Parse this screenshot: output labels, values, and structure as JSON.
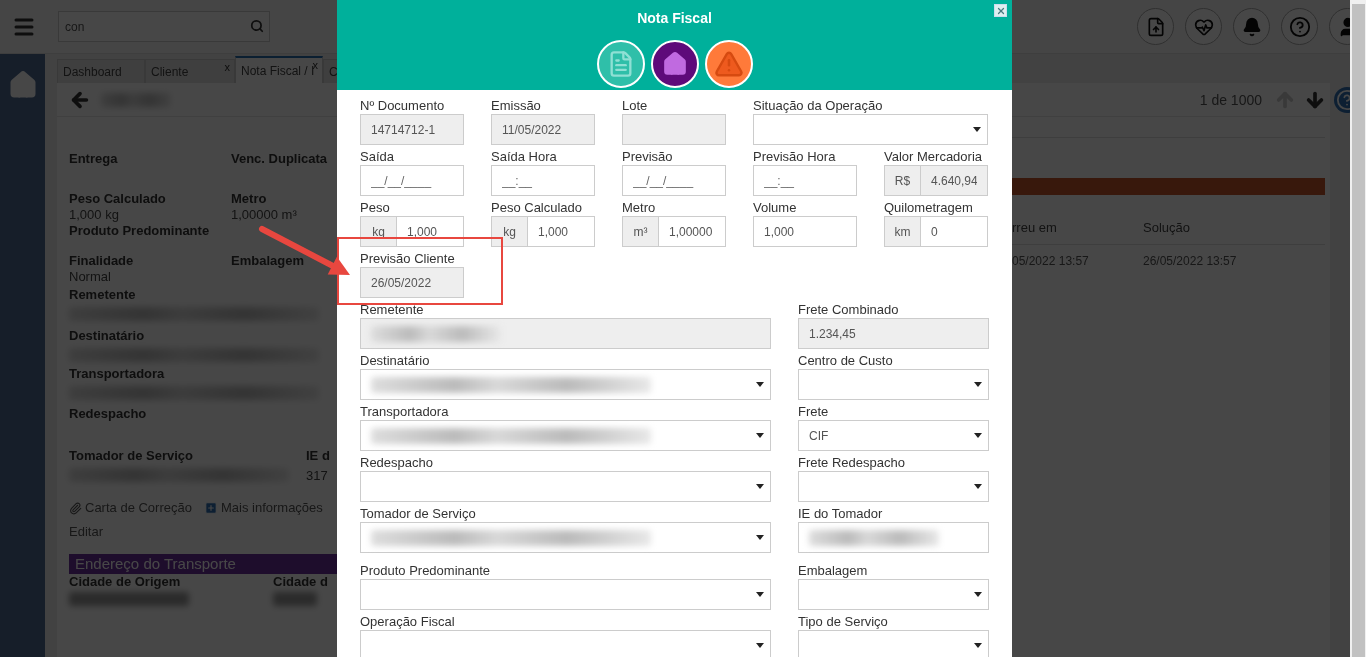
{
  "header": {
    "search": {
      "value": "con"
    }
  },
  "tabs": [
    {
      "label": "Dashboard",
      "selected": false
    },
    {
      "label": "Cliente",
      "selected": false,
      "close": "x"
    },
    {
      "label": "Nota Fiscal / I",
      "selected": true,
      "close": "x"
    },
    {
      "label": "C",
      "selected": false
    }
  ],
  "pager": {
    "text": "1 de 1000"
  },
  "details": [
    [
      {
        "label": "Entrega"
      },
      {
        "label": "Venc. Duplicata"
      }
    ],
    [
      {
        "label": "Peso Calculado",
        "value": "1,000 kg"
      },
      {
        "label": "Metro",
        "value": "1,00000 m³"
      }
    ],
    [
      {
        "label": "Produto Predominante"
      }
    ],
    [
      {
        "label": "Finalidade",
        "value": "Normal"
      },
      {
        "label": "Embalagem"
      }
    ],
    [
      {
        "label": "Remetente",
        "blurred": true
      }
    ],
    [
      {
        "label": "Destinatário",
        "blurred": true
      }
    ],
    [
      {
        "label": "Transportadora",
        "blurred": true
      }
    ],
    [
      {
        "label": "Redespacho"
      }
    ],
    [
      {
        "label": "Tomador de Serviço",
        "blurred": true
      },
      {
        "label": "IE d",
        "value": "317"
      }
    ]
  ],
  "links": [
    {
      "label": "Carta de Correção",
      "kind": "attachment"
    },
    {
      "label": "Mais informações",
      "kind": "expand"
    }
  ],
  "edit_link": "Editar",
  "section": {
    "title": "Endereço do Transporte",
    "fields": [
      {
        "label": "Cidade de Origem",
        "blurred": true
      },
      {
        "label": "Cidade d",
        "blurred": true
      }
    ]
  },
  "occurrences": {
    "columns": [
      "rreu em",
      "Solução"
    ],
    "rows": [
      [
        "05/2022 13:57",
        "26/05/2022 13:57"
      ]
    ]
  },
  "modal": {
    "title": "Nota Fiscal",
    "rows": [
      {
        "kind": "grid",
        "fields": [
          {
            "label": "Nº Documento",
            "kind": "text",
            "value": "14714712-1",
            "readonly": true
          },
          {
            "label": "Emissão",
            "kind": "text",
            "value": "11/05/2022",
            "readonly": true
          },
          {
            "label": "Lote",
            "kind": "text",
            "readonly": true
          },
          {
            "label": "Situação da Operação",
            "kind": "select",
            "readonly": false,
            "wide": true
          }
        ]
      },
      {
        "kind": "grid",
        "fields": [
          {
            "label": "Saída",
            "kind": "text",
            "placeholder": "__/__/____",
            "readonly": false
          },
          {
            "label": "Saída Hora",
            "kind": "text",
            "placeholder": "__:__",
            "readonly": false
          },
          {
            "label": "Previsão",
            "kind": "text",
            "placeholder": "__/__/____",
            "readonly": false
          },
          {
            "label": "Previsão Hora",
            "kind": "text",
            "placeholder": "__:__",
            "readonly": false
          },
          {
            "label": "Valor Mercadoria",
            "kind": "addon",
            "addon": "R$",
            "value": "4.640,94",
            "readonly": true
          }
        ]
      },
      {
        "kind": "grid",
        "fields": [
          {
            "label": "Peso",
            "kind": "addon",
            "addon": "kg",
            "value": "1,000",
            "readonly": false
          },
          {
            "label": "Peso Calculado",
            "kind": "addon",
            "addon": "kg",
            "value": "1,000",
            "readonly": false
          },
          {
            "label": "Metro",
            "kind": "addon",
            "addon": "m³",
            "value": "1,00000",
            "readonly": false
          },
          {
            "label": "Volume",
            "kind": "text",
            "value": "1,000",
            "readonly": false
          },
          {
            "label": "Quilometragem",
            "kind": "addon",
            "addon": "km",
            "value": "0",
            "readonly": false
          }
        ]
      },
      {
        "kind": "grid",
        "fields": [
          {
            "label": "Previsão Cliente",
            "kind": "text",
            "value": "26/05/2022",
            "readonly": true
          }
        ]
      },
      {
        "kind": "pair",
        "fields": [
          {
            "label": "Remetente",
            "kind": "text",
            "readonly": true,
            "blurred": true
          },
          {
            "label": "Frete Combinado",
            "kind": "text",
            "value": "1.234,45",
            "readonly": true
          }
        ]
      },
      {
        "kind": "pair",
        "fields": [
          {
            "label": "Destinatário",
            "kind": "select",
            "readonly": false,
            "blurred": true
          },
          {
            "label": "Centro de Custo",
            "kind": "select",
            "readonly": false
          }
        ]
      },
      {
        "kind": "pair",
        "fields": [
          {
            "label": "Transportadora",
            "kind": "select",
            "readonly": false,
            "blurred": true
          },
          {
            "label": "Frete",
            "kind": "select",
            "value": "CIF",
            "readonly": false
          }
        ]
      },
      {
        "kind": "pair",
        "fields": [
          {
            "label": "Redespacho",
            "kind": "select",
            "readonly": false
          },
          {
            "label": "Frete Redespacho",
            "kind": "select",
            "readonly": false
          }
        ]
      },
      {
        "kind": "pair",
        "fields": [
          {
            "label": "Tomador de Serviço",
            "kind": "select",
            "readonly": false,
            "blurred": true
          },
          {
            "label": "IE do Tomador",
            "kind": "text",
            "readonly": false,
            "blurred": true
          }
        ]
      },
      {
        "kind": "pair",
        "fields": [
          {
            "label": "Produto Predominante",
            "kind": "select",
            "readonly": false
          },
          {
            "label": "Embalagem",
            "kind": "select",
            "readonly": false
          }
        ]
      },
      {
        "kind": "pair",
        "fields": [
          {
            "label": "Operação Fiscal",
            "kind": "select",
            "readonly": false
          },
          {
            "label": "Tipo de Serviço",
            "kind": "select",
            "readonly": false
          }
        ]
      }
    ]
  }
}
